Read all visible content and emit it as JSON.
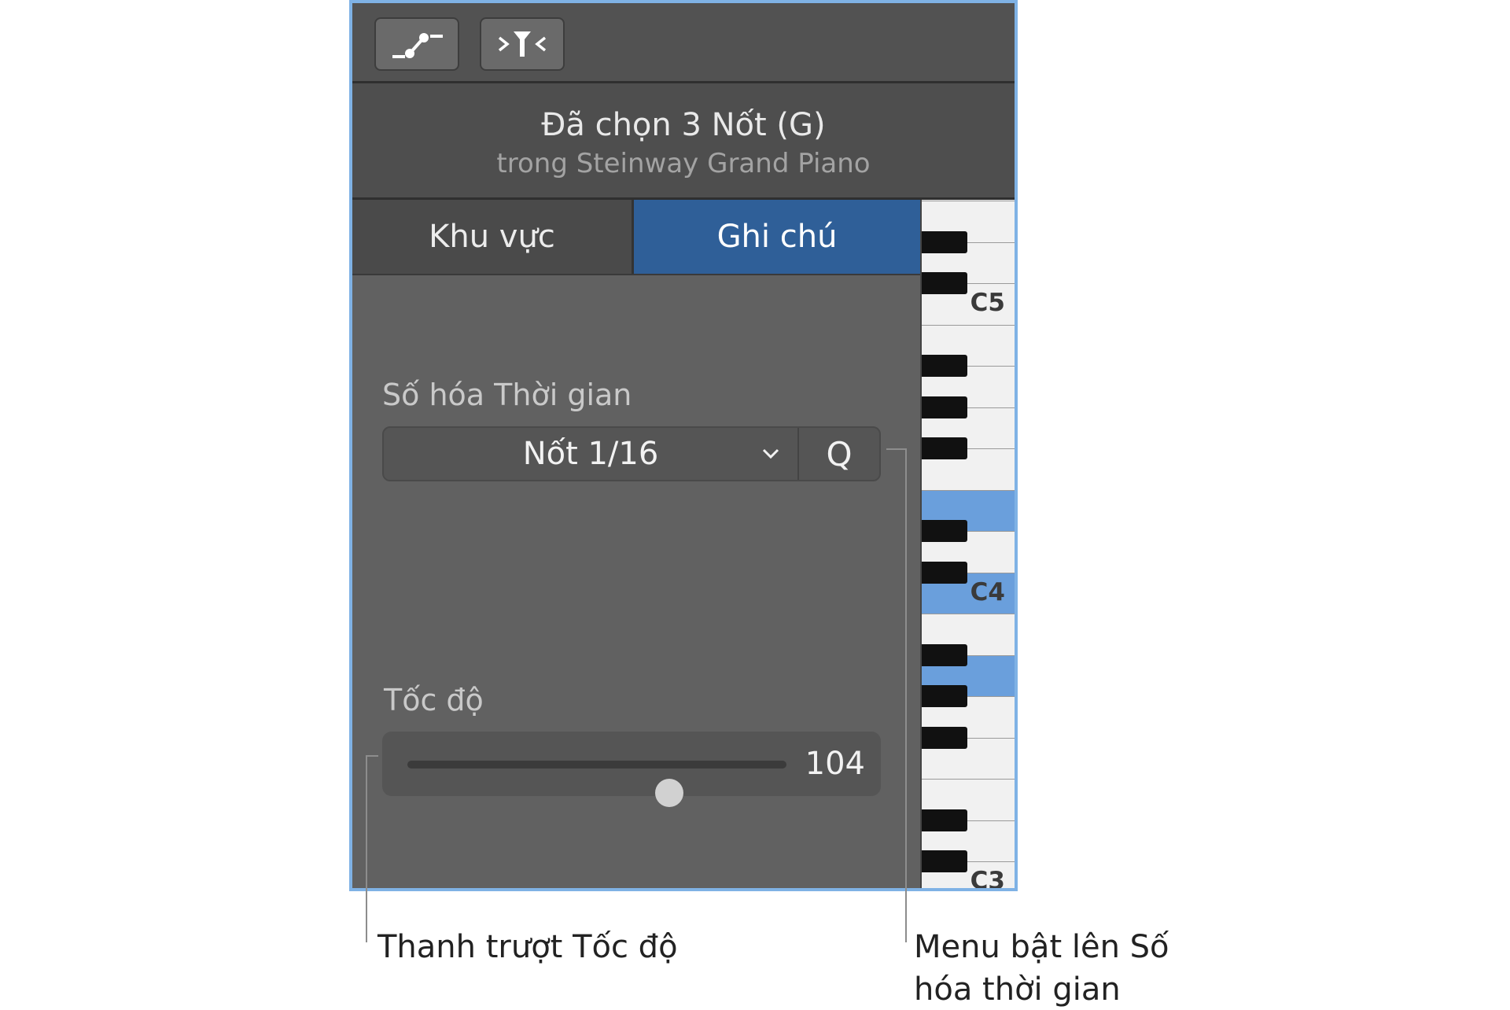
{
  "header": {
    "title": "Đã chọn 3 Nốt (G)",
    "subtitle": "trong Steinway Grand Piano"
  },
  "toolbar": {
    "buttons": [
      {
        "icon": "automation-curve-icon"
      },
      {
        "icon": "midi-filter-icon"
      }
    ]
  },
  "tabs": [
    {
      "label": "Khu vực",
      "selected": false
    },
    {
      "label": "Ghi chú",
      "selected": true
    }
  ],
  "quantize": {
    "label": "Số hóa Thời gian",
    "value": "Nốt 1/16",
    "q_button": "Q"
  },
  "velocity": {
    "label": "Tốc độ",
    "value": "104",
    "level_fraction": 0.69
  },
  "keyboard": {
    "labels": [
      "C5",
      "C4",
      "C3"
    ]
  },
  "callouts": {
    "velocity_slider": "Thanh trượt Tốc độ",
    "quantize_menu_line1": "Menu bật lên Số",
    "quantize_menu_line2": "hóa thời gian"
  },
  "colors": {
    "accent_blue": "#2f5f98",
    "selected_key": "#6a9fdc",
    "frame_border": "#7fb2e5"
  }
}
